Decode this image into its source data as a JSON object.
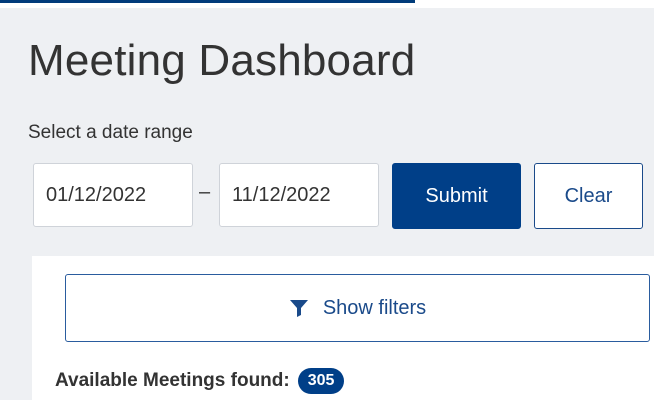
{
  "page": {
    "title": "Meeting Dashboard"
  },
  "date_range": {
    "label": "Select a date range",
    "start_value": "01/12/2022",
    "separator": "–",
    "end_value": "11/12/2022"
  },
  "actions": {
    "submit_label": "Submit",
    "clear_label": "Clear"
  },
  "filters": {
    "toggle_label": "Show filters",
    "icon": "filter-icon"
  },
  "results": {
    "found_label": "Available Meetings found:",
    "count": "305"
  },
  "colors": {
    "primary": "#003f88",
    "accent_bar": "#003b7a",
    "background": "#eef0f3"
  }
}
